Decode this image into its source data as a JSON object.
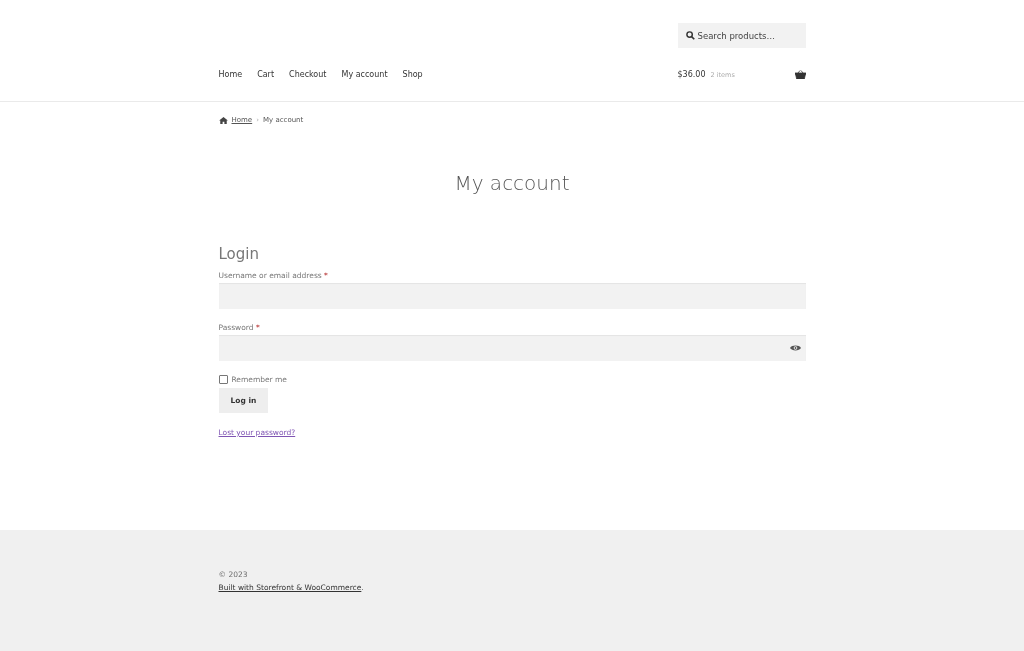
{
  "search": {
    "placeholder": "Search products…"
  },
  "nav": [
    {
      "label": "Home"
    },
    {
      "label": "Cart"
    },
    {
      "label": "Checkout"
    },
    {
      "label": "My account"
    },
    {
      "label": "Shop"
    }
  ],
  "cart": {
    "total": "$36.00",
    "count": "2 items"
  },
  "breadcrumb": {
    "home": "Home",
    "separator": "›",
    "current": "My account"
  },
  "page_title": "My account",
  "login": {
    "heading": "Login",
    "fields": [
      {
        "label": "Username or email address",
        "required": "*",
        "kind": "text"
      },
      {
        "label": "Password",
        "required": "*",
        "kind": "password"
      }
    ],
    "remember": {
      "label": "Remember me",
      "checked": false
    },
    "button": "Log in",
    "lost_password": "Lost your password?"
  },
  "footer": {
    "copyright": "© 2023",
    "credit_link": "Built with Storefront & WooCommerce",
    "credit_suffix": "."
  }
}
